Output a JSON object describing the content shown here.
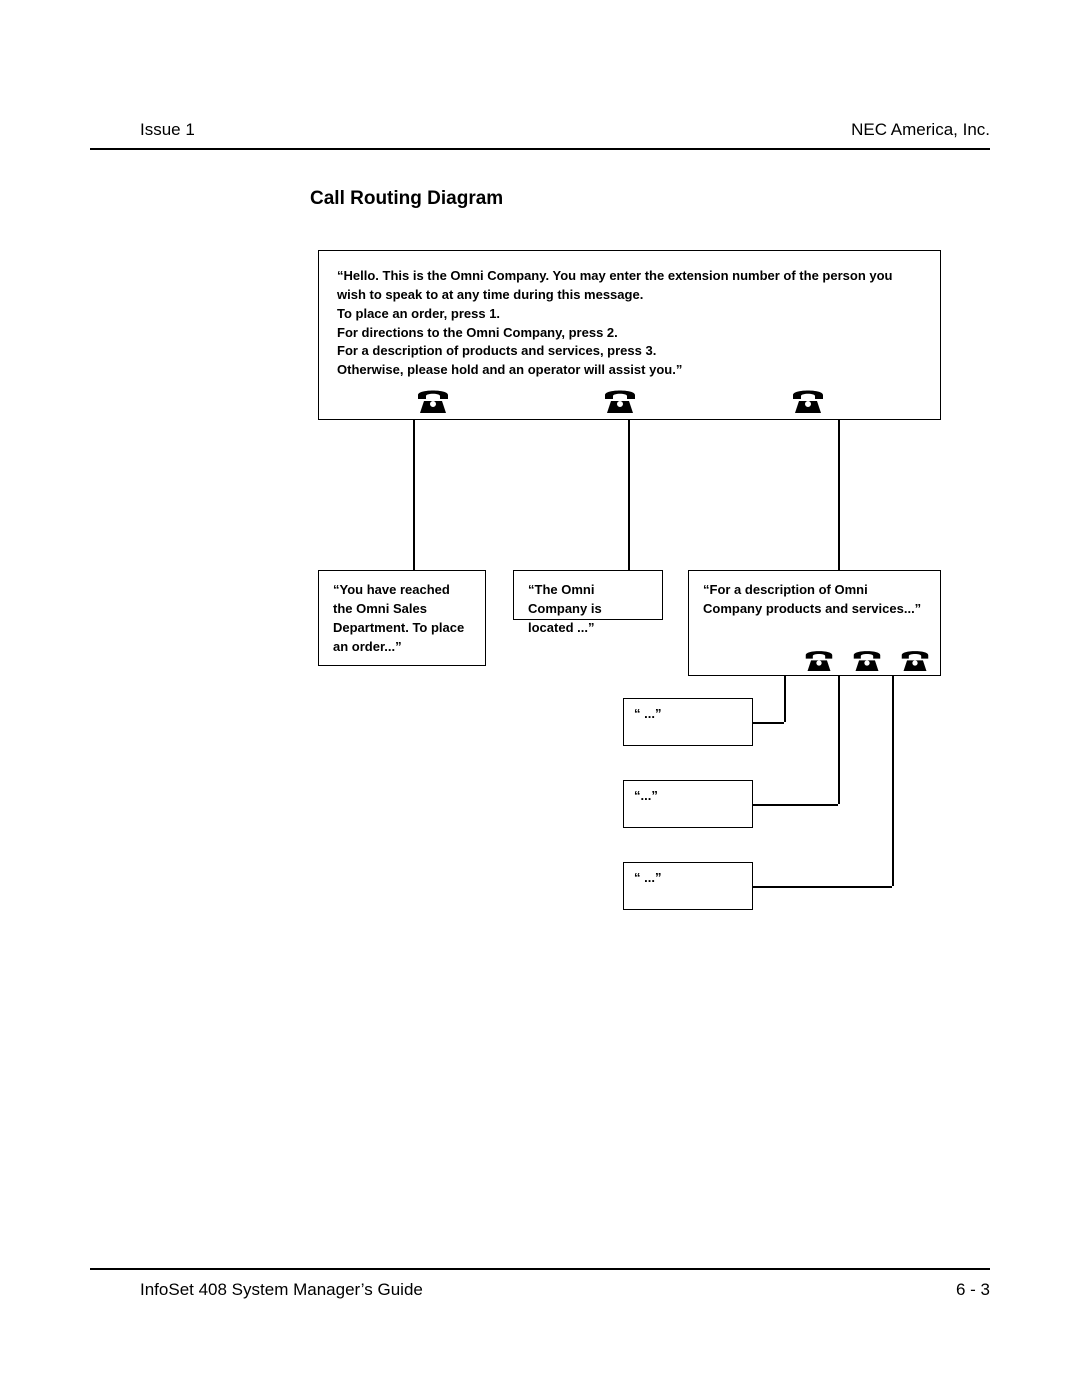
{
  "header": {
    "left": "Issue 1",
    "right": "NEC America, Inc."
  },
  "section_title": "Call Routing Diagram",
  "diagram": {
    "main_message": "“Hello. This is the Omni Company. You may enter the extension number of the person you wish to speak to at any time during this message.\nTo place an order, press 1.\nFor directions to the Omni Company, press 2.\nFor a description of products and services, press 3.\nOtherwise, please hold and an operator will assist you.”",
    "branch1": "“You have reached the Omni Sales Department. To place an order...”",
    "branch2": "“The Omni Company is located ...”",
    "branch3": "“For a description of Omni Company products and services...”",
    "leaf1": "“ ...”",
    "leaf2": "“...”",
    "leaf3": "“ ...”"
  },
  "footer": {
    "left": "InfoSet 408 System Manager’s Guide",
    "right": "6 - 3"
  }
}
